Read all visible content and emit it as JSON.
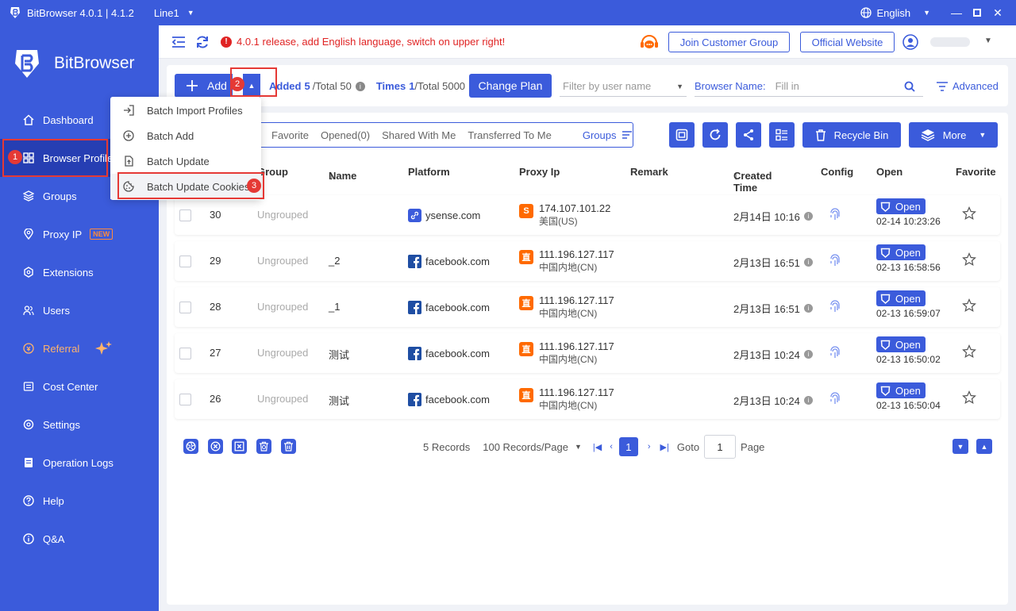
{
  "titlebar": {
    "app_title": "BitBrowser 4.0.1 | 4.1.2",
    "line": "Line1",
    "language": "English"
  },
  "sidebar": {
    "brand": "BitBrowser",
    "items": [
      {
        "label": "Dashboard",
        "icon": "home-icon"
      },
      {
        "label": "Browser Profiles",
        "icon": "grid-icon"
      },
      {
        "label": "Groups",
        "icon": "layers-icon"
      },
      {
        "label": "Proxy IP",
        "icon": "location-icon",
        "badge": "NEW"
      },
      {
        "label": "Extensions",
        "icon": "extension-icon"
      },
      {
        "label": "Users",
        "icon": "users-icon"
      },
      {
        "label": "Referral",
        "icon": "referral-icon"
      },
      {
        "label": "Cost Center",
        "icon": "cost-icon"
      },
      {
        "label": "Settings",
        "icon": "settings-icon"
      },
      {
        "label": "Operation Logs",
        "icon": "logs-icon"
      },
      {
        "label": "Help",
        "icon": "help-icon"
      },
      {
        "label": "Q&A",
        "icon": "qa-icon"
      }
    ]
  },
  "header": {
    "notice": "4.0.1 release, add English language, switch on upper right!",
    "join_group": "Join Customer Group",
    "official_site": "Official Website"
  },
  "toolbar": {
    "add_label": "Add",
    "added_label": "Added",
    "added_count": "5",
    "total_added": "/Total 50",
    "times_label": "Times",
    "times_count": "1",
    "total_times": "/Total 5000",
    "change_plan": "Change Plan",
    "filter_placeholder": "Filter by user name",
    "browser_name_label": "Browser Name:",
    "browser_name_placeholder": "Fill in",
    "advanced": "Advanced"
  },
  "dropdown": {
    "items": [
      "Batch Import Profiles",
      "Batch Add",
      "Batch Update",
      "Batch Update Cookies"
    ]
  },
  "annotations": [
    "1",
    "2",
    "3"
  ],
  "tabs": {
    "favorite": "Favorite",
    "opened": "Opened(0)",
    "shared": "Shared With Me",
    "transferred": "Transferred To Me",
    "groups": "Groups"
  },
  "actions": {
    "recycle_bin": "Recycle Bin",
    "more": "More"
  },
  "table": {
    "columns": {
      "group": "Group",
      "name": "Name",
      "platform": "Platform",
      "proxy": "Proxy Ip",
      "remark": "Remark",
      "created": "Created Time",
      "config": "Config",
      "open": "Open",
      "favorite": "Favorite"
    },
    "open_label": "Open",
    "rows": [
      {
        "id": "30",
        "group": "Ungrouped",
        "name": "",
        "platform": "ysense.com",
        "platform_icon": "link-icon",
        "proxy_type": "S",
        "proxy_ip": "174.107.101.22",
        "proxy_loc": "美国(US)",
        "created": "2月14日 10:16",
        "open_time": "02-14 10:23:26"
      },
      {
        "id": "29",
        "group": "Ungrouped",
        "name": "_2",
        "platform": "facebook.com",
        "platform_icon": "facebook-icon",
        "proxy_type": "直",
        "proxy_ip": "111.196.127.117",
        "proxy_loc": "中国内地(CN)",
        "created": "2月13日 16:51",
        "open_time": "02-13 16:58:56"
      },
      {
        "id": "28",
        "group": "Ungrouped",
        "name": "_1",
        "platform": "facebook.com",
        "platform_icon": "facebook-icon",
        "proxy_type": "直",
        "proxy_ip": "111.196.127.117",
        "proxy_loc": "中国内地(CN)",
        "created": "2月13日 16:51",
        "open_time": "02-13 16:59:07"
      },
      {
        "id": "27",
        "group": "Ungrouped",
        "name": "测试",
        "platform": "facebook.com",
        "platform_icon": "facebook-icon",
        "proxy_type": "直",
        "proxy_ip": "111.196.127.117",
        "proxy_loc": "中国内地(CN)",
        "created": "2月13日 10:24",
        "open_time": "02-13 16:50:02"
      },
      {
        "id": "26",
        "group": "Ungrouped",
        "name": "测试",
        "platform": "facebook.com",
        "platform_icon": "facebook-icon",
        "proxy_type": "直",
        "proxy_ip": "111.196.127.117",
        "proxy_loc": "中国内地(CN)",
        "created": "2月13日 10:24",
        "open_time": "02-13 16:50:04"
      }
    ]
  },
  "pager": {
    "records": "5 Records",
    "per_page": "100 Records/Page",
    "current": "1",
    "goto": "Goto",
    "goto_value": "1",
    "page": "Page"
  },
  "colors": {
    "primary": "#3b5bdb",
    "sidebar_active": "#263eb3",
    "annotation": "#e53935",
    "notice": "#e02424",
    "proxy_badge": "#ff6a00"
  }
}
